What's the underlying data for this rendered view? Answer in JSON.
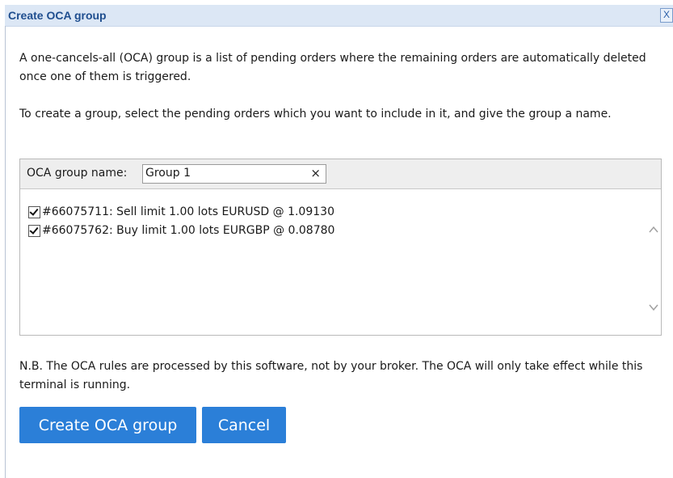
{
  "dialog": {
    "title": "Create OCA group",
    "close_label": "X"
  },
  "content": {
    "intro": "A one-cancels-all (OCA) group is a list of pending orders where the remaining orders are automatically deleted once one of them is triggered.",
    "instructions": "To create a group, select the pending orders which you want to include in it, and give the group a name.",
    "note": "N.B. The OCA rules are processed by this software, not by your broker. The OCA will only take effect while this terminal is running."
  },
  "group": {
    "name_label": "OCA group name:",
    "name_value": "Group 1",
    "clear_label": "×"
  },
  "orders": [
    {
      "checked": true,
      "label": "#66075711: Sell limit 1.00 lots EURUSD @ 1.09130"
    },
    {
      "checked": true,
      "label": "#66075762: Buy limit 1.00 lots EURGBP @ 0.08780"
    }
  ],
  "buttons": {
    "create_label": "Create OCA group",
    "cancel_label": "Cancel"
  },
  "colors": {
    "title_bar": "#dce7f5",
    "title_text": "#1f4e8f",
    "button_bg": "#2b7fd8"
  }
}
